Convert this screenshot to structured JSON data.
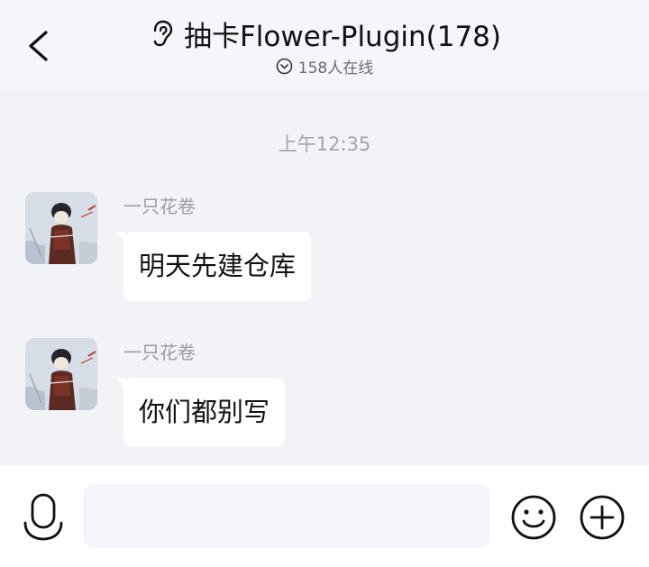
{
  "header": {
    "title": "抽卡Flower-Plugin(178)",
    "online_status": "158人在线"
  },
  "chat": {
    "timestamp": "上午12:35",
    "messages": [
      {
        "sender": "一只花卷",
        "text": "明天先建仓库"
      },
      {
        "sender": "一只花卷",
        "text": "你们都别写"
      }
    ]
  },
  "input_bar": {
    "placeholder": "",
    "value": ""
  },
  "icons": {
    "back": "back-arrow-icon",
    "listen_mode": "ear-icon",
    "online": "chevron-circle-icon",
    "voice": "microphone-icon",
    "emoji": "smiley-icon",
    "more": "plus-circle-icon"
  },
  "colors": {
    "header_bg": "#f5f6fb",
    "chat_bg": "#f2f3f7",
    "bubble_bg": "#ffffff",
    "input_bg": "#f5f6fb",
    "secondary_text": "#9b9ca4"
  }
}
